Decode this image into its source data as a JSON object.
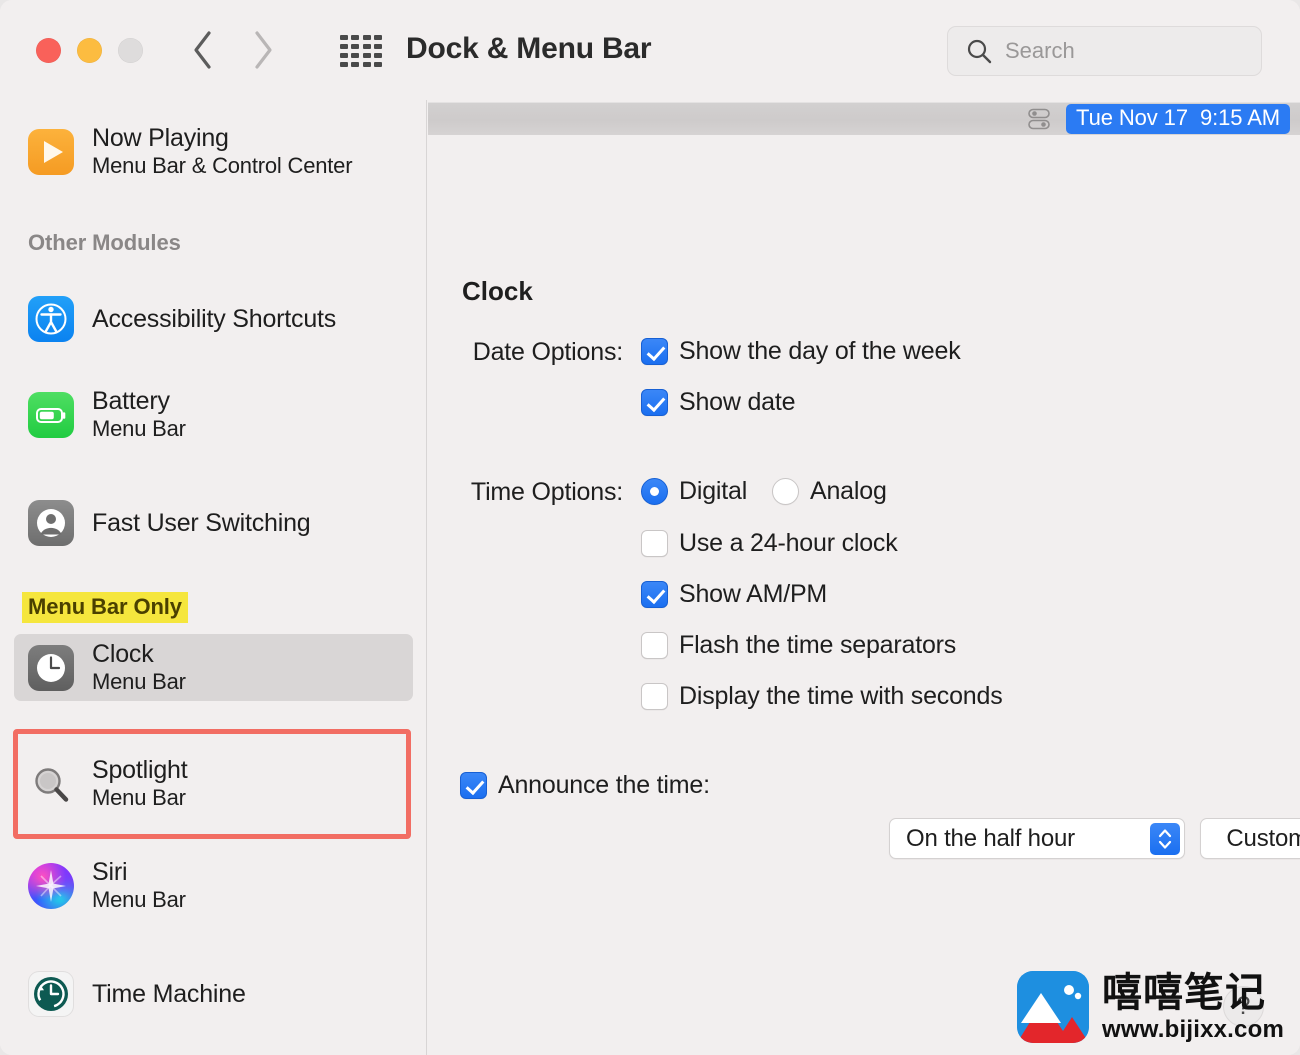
{
  "window": {
    "title": "Dock & Menu Bar",
    "traffic_lights": [
      "close",
      "minimize",
      "zoom"
    ],
    "back_label": "Back",
    "forward_label": "Forward",
    "grid_label": "Show All Preferences"
  },
  "search": {
    "placeholder": "Search",
    "value": ""
  },
  "sidebar": {
    "top_item": {
      "title": "Now Playing",
      "subtitle": "Menu Bar & Control Center",
      "icon": "now-playing-icon"
    },
    "groups": [
      {
        "label": "Other Modules",
        "highlighted": false,
        "items": [
          {
            "title": "Accessibility Shortcuts",
            "subtitle": "",
            "icon": "accessibility-icon"
          },
          {
            "title": "Battery",
            "subtitle": "Menu Bar",
            "icon": "battery-icon"
          },
          {
            "title": "Fast User Switching",
            "subtitle": "",
            "icon": "fast-user-switching-icon"
          }
        ]
      },
      {
        "label": "Menu Bar Only",
        "highlighted": true,
        "items": [
          {
            "title": "Clock",
            "subtitle": "Menu Bar",
            "icon": "clock-icon",
            "selected": true
          },
          {
            "title": "Spotlight",
            "subtitle": "Menu Bar",
            "icon": "spotlight-icon"
          },
          {
            "title": "Siri",
            "subtitle": "Menu Bar",
            "icon": "siri-icon"
          },
          {
            "title": "Time Machine",
            "subtitle": "",
            "icon": "time-machine-icon"
          }
        ]
      }
    ]
  },
  "preview": {
    "control_center_icon": "control-center-icon",
    "clock_badge": "Tue Nov 17  9:15 AM"
  },
  "main": {
    "section_title": "Clock",
    "date_options": {
      "label": "Date Options:",
      "items": [
        {
          "label": "Show the day of the week",
          "checked": true
        },
        {
          "label": "Show date",
          "checked": true
        }
      ]
    },
    "time_options": {
      "label": "Time Options:",
      "radios": [
        {
          "label": "Digital",
          "selected": true
        },
        {
          "label": "Analog",
          "selected": false
        }
      ],
      "checkboxes": [
        {
          "label": "Use a 24-hour clock",
          "checked": false
        },
        {
          "label": "Show AM/PM",
          "checked": true
        },
        {
          "label": "Flash the time separators",
          "checked": false
        },
        {
          "label": "Display the time with seconds",
          "checked": false
        }
      ]
    },
    "announce": {
      "label": "Announce the time:",
      "checked": true,
      "interval_value": "On the half hour",
      "customize_button": "Customize Voice..."
    },
    "help_label": "?"
  },
  "watermark": {
    "brand_cn": "嘻嘻笔记",
    "url": "www.bijixx.com"
  },
  "colors": {
    "accent_blue": "#1b6ff0",
    "badge_blue": "#2b7bf3",
    "highlight_yellow": "#f5e63d",
    "callout_red": "#f26d63",
    "window_bg": "#f2efef",
    "selected_row": "#d9d6d6"
  }
}
